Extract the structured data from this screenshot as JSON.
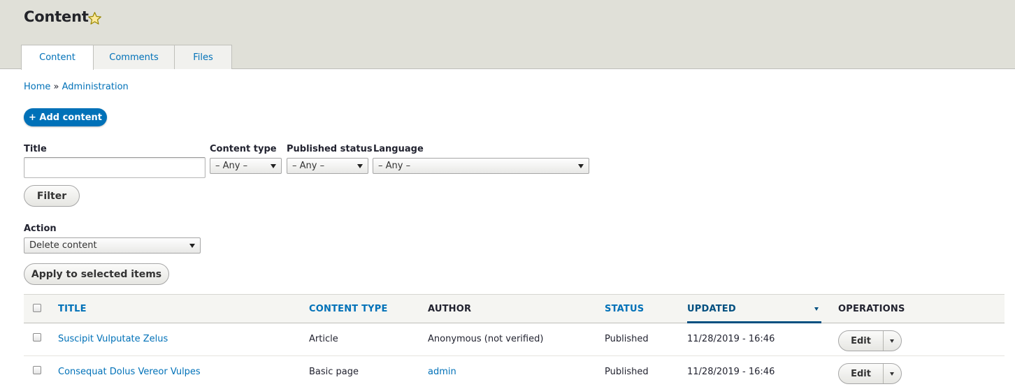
{
  "page_title": "Content",
  "tabs": [
    {
      "label": "Content",
      "active": true
    },
    {
      "label": "Comments",
      "active": false
    },
    {
      "label": "Files",
      "active": false
    }
  ],
  "breadcrumb": {
    "home": "Home",
    "separator": "»",
    "admin": "Administration"
  },
  "add_content_button": "+ Add content",
  "filters": {
    "title_label": "Title",
    "title_value": "",
    "content_type_label": "Content type",
    "content_type_value": "– Any –",
    "published_status_label": "Published status",
    "published_status_value": "– Any –",
    "language_label": "Language",
    "language_value": "– Any –",
    "filter_button": "Filter"
  },
  "bulk": {
    "action_label": "Action",
    "action_value": "Delete content",
    "apply_button": "Apply to selected items"
  },
  "table": {
    "headers": {
      "title": "TITLE",
      "content_type": "CONTENT TYPE",
      "author": "AUTHOR",
      "status": "STATUS",
      "updated": "UPDATED",
      "operations": "OPERATIONS"
    },
    "sorted_by": "updated",
    "rows": [
      {
        "title": "Suscipit Vulputate Zelus",
        "content_type": "Article",
        "author": "Anonymous (not verified)",
        "author_is_link": false,
        "status": "Published",
        "updated": "11/28/2019 - 16:46",
        "operation": "Edit"
      },
      {
        "title": "Consequat Dolus Vereor Vulpes",
        "content_type": "Basic page",
        "author": "admin",
        "author_is_link": true,
        "status": "Published",
        "updated": "11/28/2019 - 16:46",
        "operation": "Edit"
      }
    ]
  },
  "colors": {
    "link": "#0071b8",
    "header_bg": "#e0e0d8",
    "primary_button": "#0071b8",
    "star": "#f5d40f"
  },
  "icons": {
    "favorite": "star-icon",
    "select_arrow": "chevron-down-icon"
  }
}
